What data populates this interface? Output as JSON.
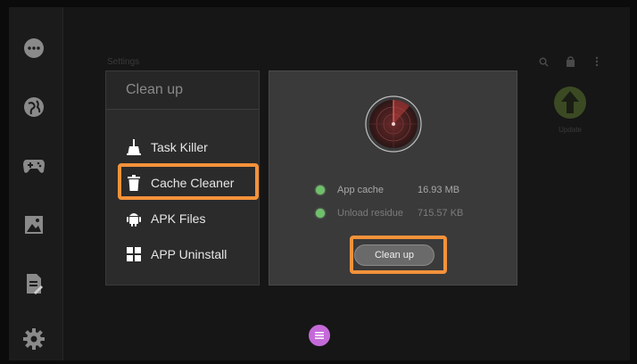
{
  "background": {
    "title": "Settings",
    "update_label": "Update"
  },
  "menu": {
    "header": "Clean up",
    "items": [
      {
        "label": "Task Killer",
        "icon": "broom-icon"
      },
      {
        "label": "Cache Cleaner",
        "icon": "trash-icon"
      },
      {
        "label": "APK Files",
        "icon": "android-icon"
      },
      {
        "label": "APP Uninstall",
        "icon": "grid-icon"
      }
    ],
    "selected": "Cache Cleaner"
  },
  "details": {
    "rows": [
      {
        "label": "App cache",
        "value": "16.93 MB"
      },
      {
        "label": "Unload residue",
        "value": "715.57 KB"
      }
    ],
    "button_label": "Clean up"
  },
  "colors": {
    "highlight": "#f4923a",
    "status_dot": "#6fc06a",
    "fab": "#c56ad9"
  }
}
